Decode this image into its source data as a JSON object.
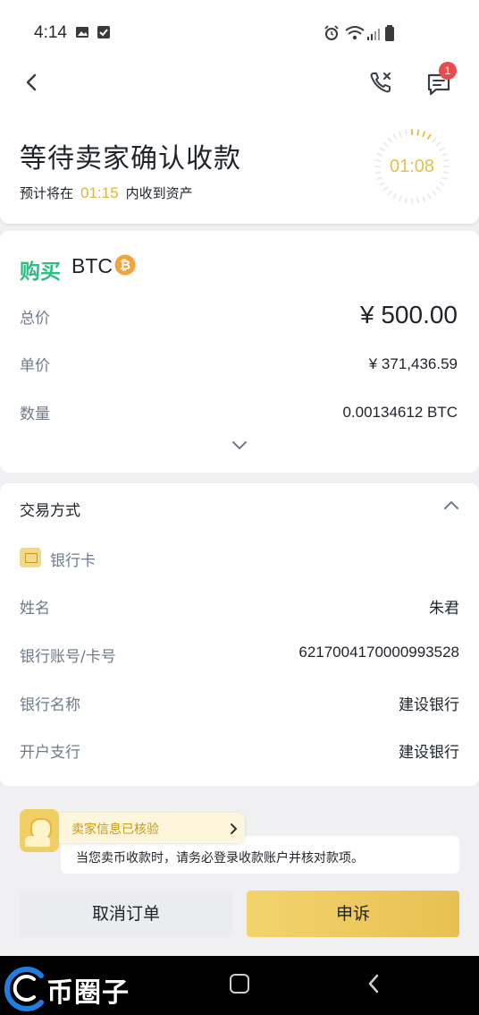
{
  "status_bar": {
    "time": "4:14",
    "icons": [
      "image-icon",
      "check-square-icon",
      "alarm-icon",
      "wifi-icon",
      "signal-icon",
      "battery-icon"
    ]
  },
  "header": {
    "title": "等待卖家确认收款",
    "subtitle_prefix": "预计将在",
    "subtitle_time": "01:15",
    "subtitle_suffix": "内收到资产",
    "timer": "01:08",
    "chat_badge": "1"
  },
  "order": {
    "side": "购买",
    "coin": "BTC",
    "rows": [
      {
        "label": "总价",
        "value": "¥ 500.00"
      },
      {
        "label": "单价",
        "value": "¥ 371,436.59"
      },
      {
        "label": "数量",
        "value": "0.00134612 BTC"
      }
    ]
  },
  "payment": {
    "title": "交易方式",
    "method": "银行卡",
    "rows": [
      {
        "label": "姓名",
        "value": "朱君"
      },
      {
        "label": "银行账号/卡号",
        "value": "6217004170000993528"
      },
      {
        "label": "银行名称",
        "value": "建设银行"
      },
      {
        "label": "开户支行",
        "value": "建设银行"
      }
    ]
  },
  "notice": {
    "verified_label": "卖家信息已核验",
    "text": "当您卖币收款时，请务必登录收款账户并核对款项。"
  },
  "actions": {
    "cancel_label": "取消订单",
    "appeal_label": "申诉"
  },
  "watermark": {
    "text": "币圈子"
  },
  "colors": {
    "buy_green": "#2ebd85",
    "accent_yellow": "#f0c95a",
    "badge_red": "#e84c4c"
  }
}
